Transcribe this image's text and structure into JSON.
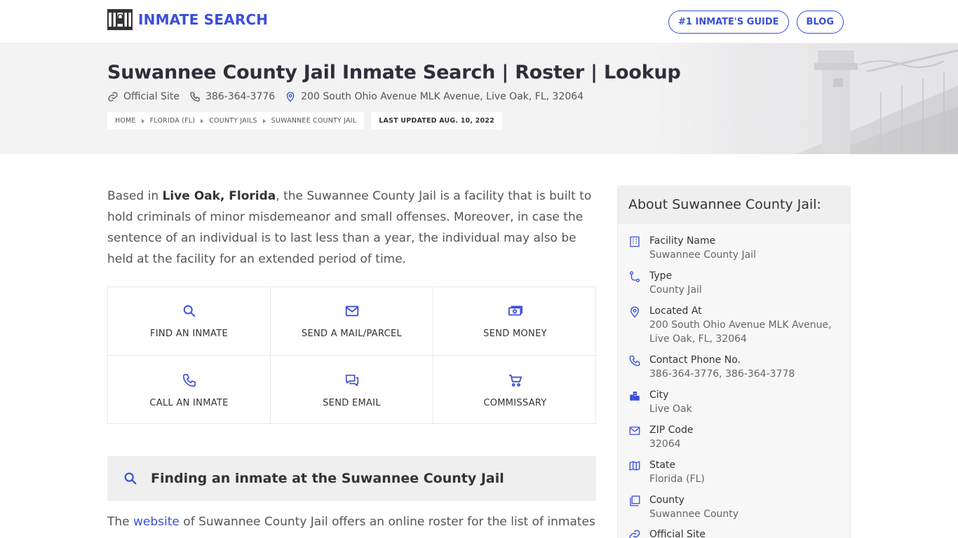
{
  "header": {
    "logo_text": "INMATE SEARCH",
    "nav": [
      "#1 INMATE'S GUIDE",
      "BLOG"
    ]
  },
  "hero": {
    "title": "Suwannee County Jail Inmate Search | Roster | Lookup",
    "official_site": "Official Site",
    "phone": "386-364-3776",
    "address": "200 South Ohio Avenue MLK Avenue, Live Oak, FL, 32064",
    "breadcrumbs": [
      "HOME",
      "FLORIDA (FL)",
      "COUNTY JAILS",
      "SUWANNEE COUNTY JAIL"
    ],
    "updated": "LAST UPDATED AUG. 10, 2022"
  },
  "intro": {
    "pre": "Based in ",
    "location": "Live Oak, Florida",
    "post": ", the Suwannee County Jail is a facility that is built to hold criminals of minor misdemeanor and small offenses. Moreover, in case the sentence of an individual is to last less than a year, the individual may also be held at the facility for an extended period of time."
  },
  "actions": [
    {
      "label": "FIND AN INMATE",
      "icon": "search-icon"
    },
    {
      "label": "SEND A MAIL/PARCEL",
      "icon": "mail-icon"
    },
    {
      "label": "SEND MONEY",
      "icon": "money-icon"
    },
    {
      "label": "CALL AN INMATE",
      "icon": "phone-icon"
    },
    {
      "label": "SEND EMAIL",
      "icon": "chat-icon"
    },
    {
      "label": "COMMISSARY",
      "icon": "cart-icon"
    }
  ],
  "section": {
    "title": "Finding an inmate at the Suwannee County Jail"
  },
  "para2": {
    "pre": "The ",
    "link": "website",
    "post": " of Suwannee County Jail offers an online roster for the list of inmates"
  },
  "sidebar": {
    "title": "About Suwannee County Jail:",
    "items": [
      {
        "key": "Facility Name",
        "value": "Suwannee County Jail",
        "icon": "building-icon"
      },
      {
        "key": "Type",
        "value": "County Jail",
        "icon": "route-icon"
      },
      {
        "key": "Located At",
        "value": "200 South Ohio Avenue MLK Avenue, Live Oak, FL, 32064",
        "icon": "location-pin-icon"
      },
      {
        "key": "Contact Phone No.",
        "value": "386-364-3776, 386-364-3778",
        "icon": "phone-icon"
      },
      {
        "key": "City",
        "value": "Live Oak",
        "icon": "city-icon"
      },
      {
        "key": "ZIP Code",
        "value": "32064",
        "icon": "mail-icon"
      },
      {
        "key": "State",
        "value": "Florida (FL)",
        "icon": "map-icon"
      },
      {
        "key": "County",
        "value": "Suwannee County",
        "icon": "copy-icon"
      },
      {
        "key": "Official Site",
        "value": "",
        "icon": "link-icon"
      }
    ]
  },
  "colors": {
    "accent": "#3b4fd8",
    "text": "#555555",
    "heading": "#2f2f3a",
    "panel": "#efeff0"
  }
}
